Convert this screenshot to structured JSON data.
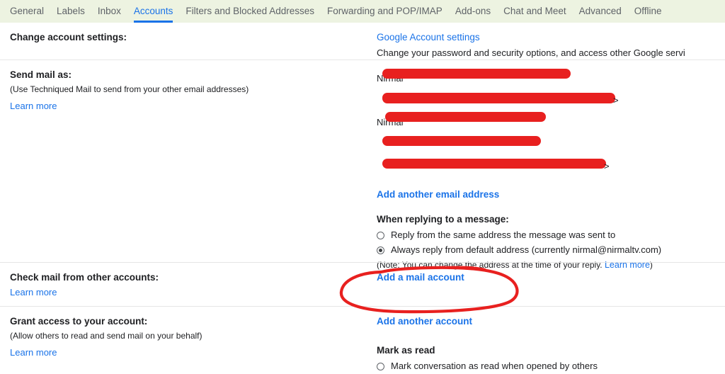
{
  "tabs": [
    {
      "label": "General",
      "active": false
    },
    {
      "label": "Labels",
      "active": false
    },
    {
      "label": "Inbox",
      "active": false
    },
    {
      "label": "Accounts",
      "active": true
    },
    {
      "label": "Filters and Blocked Addresses",
      "active": false
    },
    {
      "label": "Forwarding and POP/IMAP",
      "active": false
    },
    {
      "label": "Add-ons",
      "active": false
    },
    {
      "label": "Chat and Meet",
      "active": false
    },
    {
      "label": "Advanced",
      "active": false
    },
    {
      "label": "Offline",
      "active": false
    }
  ],
  "change_account": {
    "label": "Change account settings:",
    "link": "Google Account settings",
    "description": "Change your password and security options, and access other Google servi"
  },
  "send_mail_as": {
    "label": "Send mail as:",
    "sub": "(Use Techniqued Mail to send from your other email addresses)",
    "learn_more": "Learn more",
    "addresses": [
      {
        "visible_text": "Nirmal",
        "redacted": true
      },
      {
        "visible_text": "",
        "redacted": true
      },
      {
        "visible_text": "Nirmal",
        "redacted": true
      },
      {
        "visible_text": "",
        "redacted": true
      },
      {
        "visible_text": "",
        "redacted": true
      }
    ],
    "add_link": "Add another email address",
    "reply_group_title": "When replying to a message:",
    "reply_options": [
      {
        "label": "Reply from the same address the message was sent to",
        "checked": false
      },
      {
        "label": "Always reply from default address (currently nirmal@nirmaltv.com)",
        "checked": true
      }
    ],
    "note_prefix": "(Note: You can change the address at the time of your reply. ",
    "note_link": "Learn more",
    "note_suffix": ")"
  },
  "check_mail": {
    "label": "Check mail from other accounts:",
    "learn_more": "Learn more",
    "add_link": "Add a mail account"
  },
  "grant_access": {
    "label": "Grant access to your account:",
    "sub": "(Allow others to read and send mail on your behalf)",
    "learn_more": "Learn more",
    "add_link": "Add another account",
    "mark_as_read_title": "Mark as read",
    "mark_as_read_option": "Mark conversation as read when opened by others"
  },
  "annotation": {
    "color": "#e8201f",
    "shape": "hand-drawn-ellipse",
    "targets": "Add a mail account"
  },
  "colors": {
    "accent": "#1a73e8",
    "tabbar_bg": "#edf3e1",
    "redaction": "#e8201f",
    "text": "#202124"
  }
}
